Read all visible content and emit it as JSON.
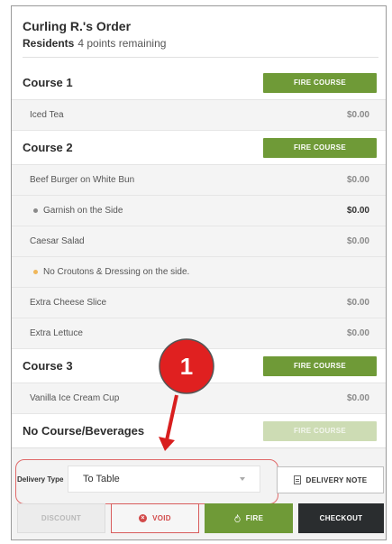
{
  "order": {
    "title": "Curling R.'s Order",
    "residents_label": "Residents",
    "points_text": "4 points remaining"
  },
  "courses": [
    {
      "name": "Course 1",
      "fire_label": "FIRE COURSE",
      "items": [
        {
          "name": "Iced Tea",
          "price": "$0.00"
        }
      ]
    },
    {
      "name": "Course 2",
      "fire_label": "FIRE COURSE",
      "items": [
        {
          "name": "Beef Burger on White Bun",
          "price": "$0.00"
        },
        {
          "name": "Garnish on the Side",
          "price": "$0.00"
        },
        {
          "name": "Caesar Salad",
          "price": "$0.00"
        },
        {
          "name": "No Croutons & Dressing on the side.",
          "price": ""
        },
        {
          "name": "Extra Cheese Slice",
          "price": "$0.00"
        },
        {
          "name": "Extra Lettuce",
          "price": "$0.00"
        }
      ]
    },
    {
      "name": "Course 3",
      "fire_label": "FIRE COURSE",
      "items": [
        {
          "name": "Vanilla Ice Cream Cup",
          "price": "$0.00"
        }
      ]
    },
    {
      "name": "No Course/Beverages",
      "fire_label": "FIRE COURSE",
      "items": []
    }
  ],
  "delivery": {
    "label": "Delivery Type",
    "selected": "To Table",
    "note_button": "DELIVERY NOTE"
  },
  "actions": {
    "discount": "DISCOUNT",
    "void": "VOID",
    "fire": "FIRE",
    "checkout": "CHECKOUT"
  },
  "annotation": {
    "number": "1"
  },
  "colors": {
    "accent_green": "#6f9a37",
    "disabled_green": "#cddcb4",
    "checkout_dark": "#2a2d2f",
    "void_red": "#d24a4a",
    "callout_red": "#e02020"
  },
  "icons": {
    "modifier_grey": "dot",
    "modifier_note": "dot-orange",
    "void": "x-circle-icon",
    "fire": "flame-icon",
    "note": "document-icon",
    "dropdown": "chevron-down-icon"
  }
}
